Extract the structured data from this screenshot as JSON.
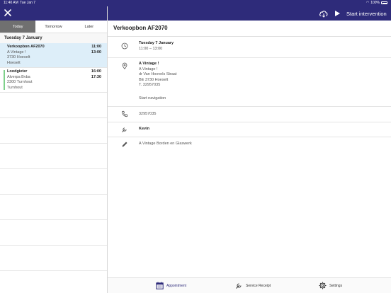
{
  "status": {
    "time": "11:40 AM",
    "date": "Tue Jan 7",
    "battery": "100%"
  },
  "header": {
    "start_label": "Start intervention"
  },
  "tabs": [
    {
      "label": "Today"
    },
    {
      "label": "Tomorrow"
    },
    {
      "label": "Later"
    }
  ],
  "list": {
    "group_label": "Tuesday 7 January",
    "items": [
      {
        "title": "Verkoopbon AF2070",
        "line1": "A Vintage !",
        "line2": "3730 Hoeselt",
        "line3": "Hoeselt",
        "start": "11:00",
        "end": "13:00"
      },
      {
        "title": "Loodgieter",
        "line1": "Alverpa Bvba",
        "line2": "2300 Turnhout",
        "line3": "Turnhout",
        "start": "16:00",
        "end": "17:30"
      }
    ]
  },
  "detail": {
    "title": "Verkoopbon AF2070",
    "date": "Tuesday 7 January",
    "time_range": "11:00 – 13:00",
    "customer": "A Vintage !",
    "address_lines": [
      "A Vintage !",
      "dr Van Hoovels Straat",
      "BE 3730 Hoeselt",
      "T. 32957035"
    ],
    "navigation_label": "Start navigation",
    "phone": "32957035",
    "technician": "Kevin",
    "note": "A Vintage Borden en Glaswerk"
  },
  "bottom_nav": [
    {
      "label": "Appointment"
    },
    {
      "label": "Service Receipt"
    },
    {
      "label": "Settings"
    }
  ],
  "colors": {
    "header": "#2e2b7a",
    "link": "#1f7ac9",
    "selected_row": "#ddeef9",
    "stripe": "#7ed08a"
  },
  "icons": [
    "close-icon",
    "cloud-sync-icon",
    "play-icon",
    "clock-icon",
    "location-pin-icon",
    "phone-icon",
    "wrench-icon",
    "pencil-icon",
    "calendar-icon",
    "settings-icon"
  ]
}
